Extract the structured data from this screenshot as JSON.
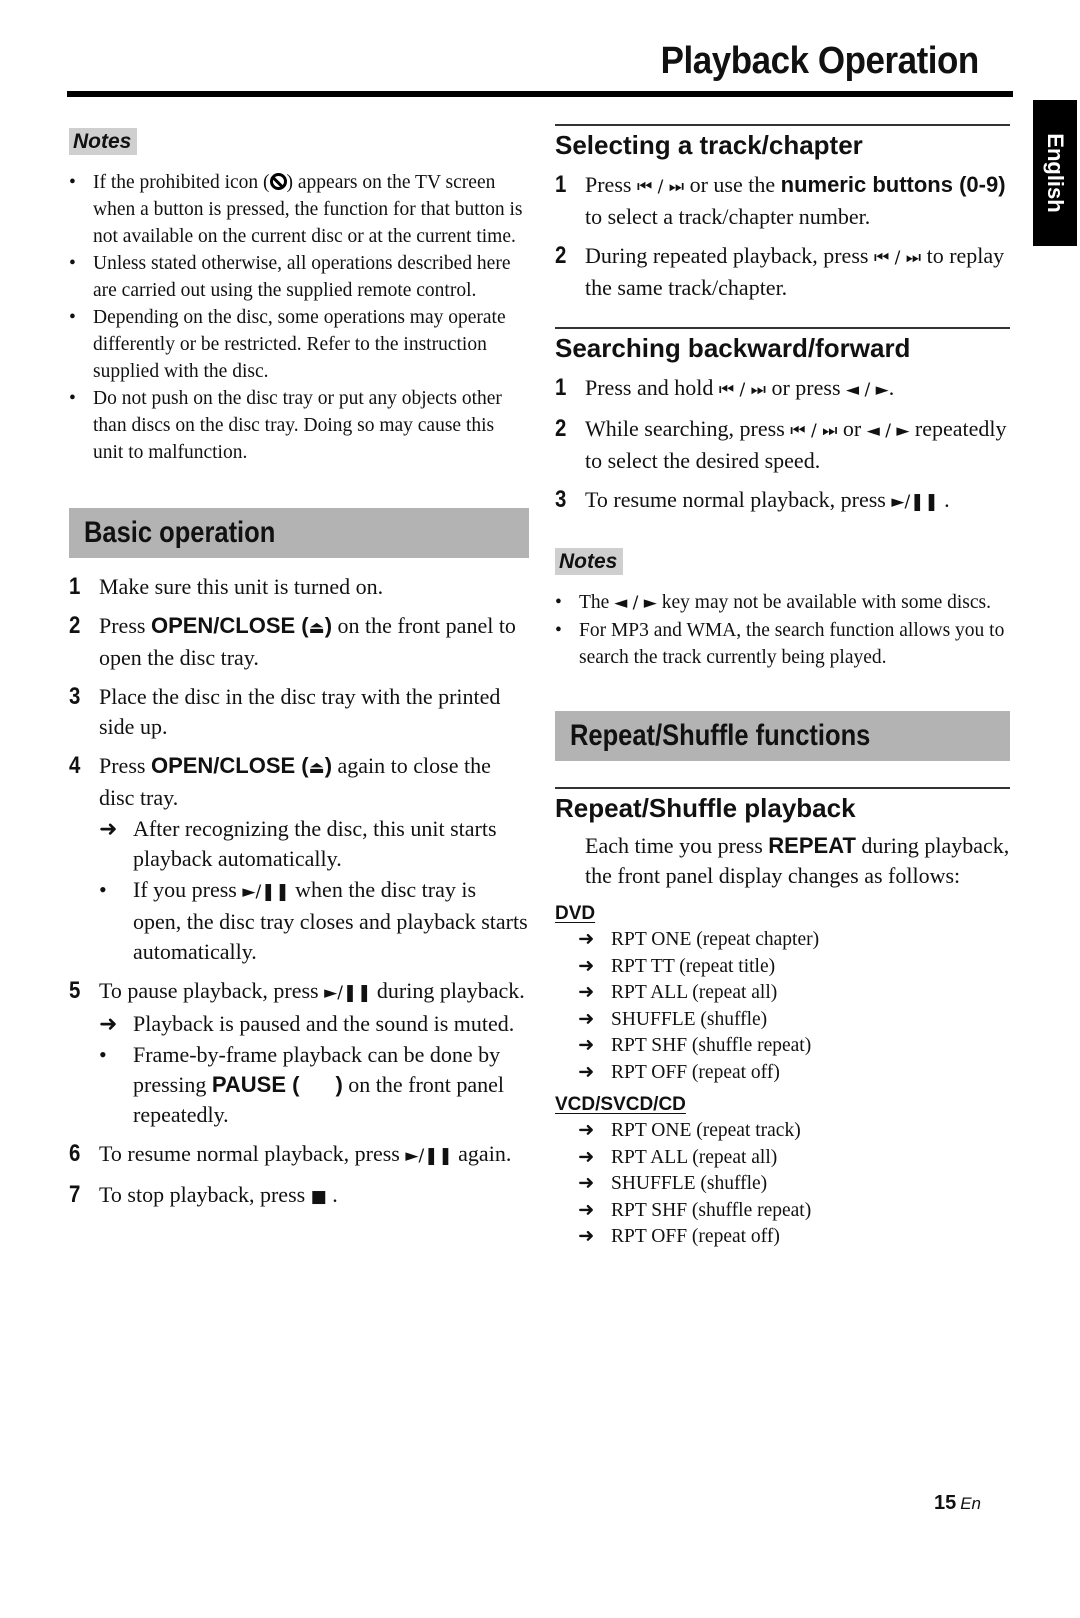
{
  "header": {
    "title": "Playback Operation",
    "language_tab": "English"
  },
  "left": {
    "notes_label": "Notes",
    "notes": [
      {
        "before": "If the prohibited icon (",
        "icon": "prohibited-icon",
        "after": ") appears on the TV screen when a button is pressed, the function for that button is not available on the current disc or at the current time."
      },
      {
        "text": "Unless stated otherwise, all operations described here are carried out using the supplied remote control."
      },
      {
        "text": "Depending on the disc, some operations may operate differently or be restricted. Refer to the instruction supplied with the disc."
      },
      {
        "text": "Do not push on the disc tray or put any objects other than discs on the disc tray. Doing so may cause this unit to malfunction."
      }
    ],
    "basic_operation": {
      "title": "Basic operation",
      "steps": [
        {
          "num": "1",
          "text": "Make sure this unit is turned on."
        },
        {
          "num": "2",
          "pre": "Press ",
          "bold": "OPEN/CLOSE (",
          "sym": "⏏",
          "bold2": ")",
          "post": " on the front panel to open the disc tray."
        },
        {
          "num": "3",
          "text": "Place the disc in the disc tray with the printed side up."
        },
        {
          "num": "4",
          "pre": "Press ",
          "bold": "OPEN/CLOSE (",
          "sym": "⏏",
          "bold2": ")",
          "post": " again to close the disc tray.",
          "result": "After recognizing the disc, this unit starts playback automatically.",
          "bullet": {
            "pre": "If you press ",
            "sym": "►/❚❚",
            "post": " when the disc tray is open, the disc tray closes and playback starts automatically."
          }
        },
        {
          "num": "5",
          "pre": "To pause playback, press ",
          "sym": "►/❚❚",
          "post": " during playback.",
          "result": "Playback is paused and the sound is muted.",
          "bullet": {
            "pre": "Frame-by-frame playback can be done by pressing ",
            "bold": "PAUSE (",
            "bold2": ")",
            "post": " on the front panel repeatedly."
          }
        },
        {
          "num": "6",
          "pre": "To resume normal playback, press ",
          "sym": "►/❚❚",
          "post": " again."
        },
        {
          "num": "7",
          "pre": "To stop playback, press ",
          "sym": "■",
          "post": " ."
        }
      ]
    }
  },
  "right": {
    "selecting": {
      "title": "Selecting a track/chapter",
      "steps": [
        {
          "num": "1",
          "pre": "Press ",
          "sym": "⏮ / ⏭",
          "mid": " or use the ",
          "bold": "numeric buttons (0-9)",
          "post": " to select a track/chapter number."
        },
        {
          "num": "2",
          "pre": "During repeated playback, press ",
          "sym": "⏮ / ⏭",
          "post": " to replay the same track/chapter."
        }
      ]
    },
    "searching": {
      "title": "Searching backward/forward",
      "steps": [
        {
          "num": "1",
          "pre": "Press and hold ",
          "sym": "⏮ / ⏭",
          "mid": " or press ",
          "sym2": "◄ / ►",
          "post": "."
        },
        {
          "num": "2",
          "pre": "While searching, press ",
          "sym": "⏮ / ⏭",
          "mid": " or ",
          "sym2": "◄ / ►",
          "post": " repeatedly to select the desired speed."
        },
        {
          "num": "3",
          "pre": "To resume normal playback, press ",
          "sym": "►/❚❚",
          "post": " ."
        }
      ]
    },
    "notes_label": "Notes",
    "notes": [
      {
        "pre": "The ",
        "sym": "◄ / ►",
        "post": " key may not be available with some discs."
      },
      {
        "text": "For MP3 and WMA, the search function allows you to search the track currently being played."
      }
    ],
    "repeat": {
      "title": "Repeat/Shuffle functions",
      "subtitle": "Repeat/Shuffle playback",
      "intro_pre": "Each time you press ",
      "intro_bold": "REPEAT",
      "intro_post": " during playback, the front panel display changes as follows:",
      "groups": [
        {
          "label": "DVD",
          "items": [
            "RPT ONE (repeat chapter)",
            "RPT TT (repeat title)",
            "RPT ALL (repeat all)",
            "SHUFFLE (shuffle)",
            "RPT SHF (shuffle repeat)",
            "RPT OFF (repeat off)"
          ]
        },
        {
          "label": "VCD/SVCD/CD",
          "items": [
            "RPT ONE (repeat track)",
            "RPT ALL (repeat all)",
            "SHUFFLE (shuffle)",
            "RPT SHF (shuffle repeat)",
            "RPT OFF (repeat off)"
          ]
        }
      ]
    }
  },
  "footer": {
    "page_number": "15",
    "page_suffix": "En"
  },
  "glyphs": {
    "arrow": "➜",
    "bullet": "•"
  }
}
